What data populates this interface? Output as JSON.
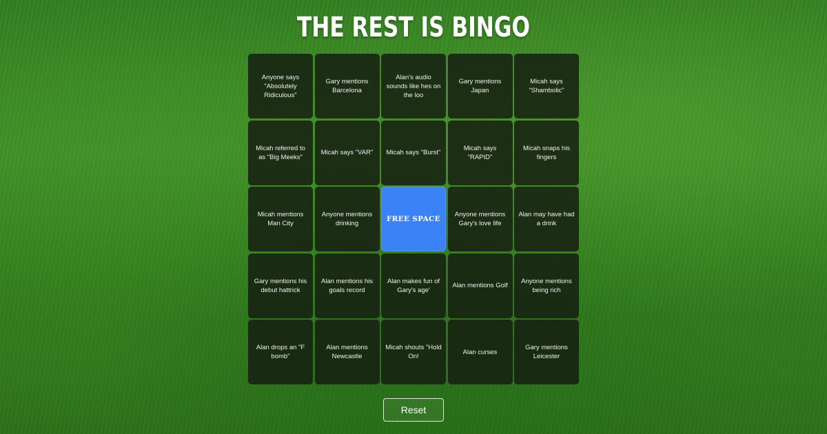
{
  "header": {
    "title": "THE REST IS BINGO"
  },
  "board": {
    "cells": [
      "Anyone says \"Absolutely Ridiculous\"",
      "Gary mentions Barcelona",
      "Alan's audio sounds like hes on the loo",
      "Gary mentions Japan",
      "Micah says \"Shambolic\"",
      "Micah referred to as \"Big Meeks\"",
      "Micah says \"VAR\"",
      "Micah says \"Burst\"",
      "Micah says \"RAPID\"",
      "Micah snaps his fingers",
      "Micah mentions Man City",
      "Anyone mentions drinking",
      "FREE SPACE",
      "Anyone mentions Gary's love life",
      "Alan may have had a drink",
      "Gary mentions his debut hattrick",
      "Alan mentions his goals record",
      "Alan makes fun of Gary's age'",
      "Alan mentions Golf",
      "Anyone mentions being rich",
      "Alan drops an \"F bomb\"",
      "Alan mentions Newcastle",
      "Micah shouts \"Hold On!",
      "Alan curses",
      "Gary mentions Leicester"
    ],
    "free_space_index": 12,
    "colors": {
      "cell_background": "#1a2215",
      "free_space": "#3b82f6",
      "background": "#2f7a1f"
    }
  },
  "controls": {
    "reset_label": "Reset"
  }
}
